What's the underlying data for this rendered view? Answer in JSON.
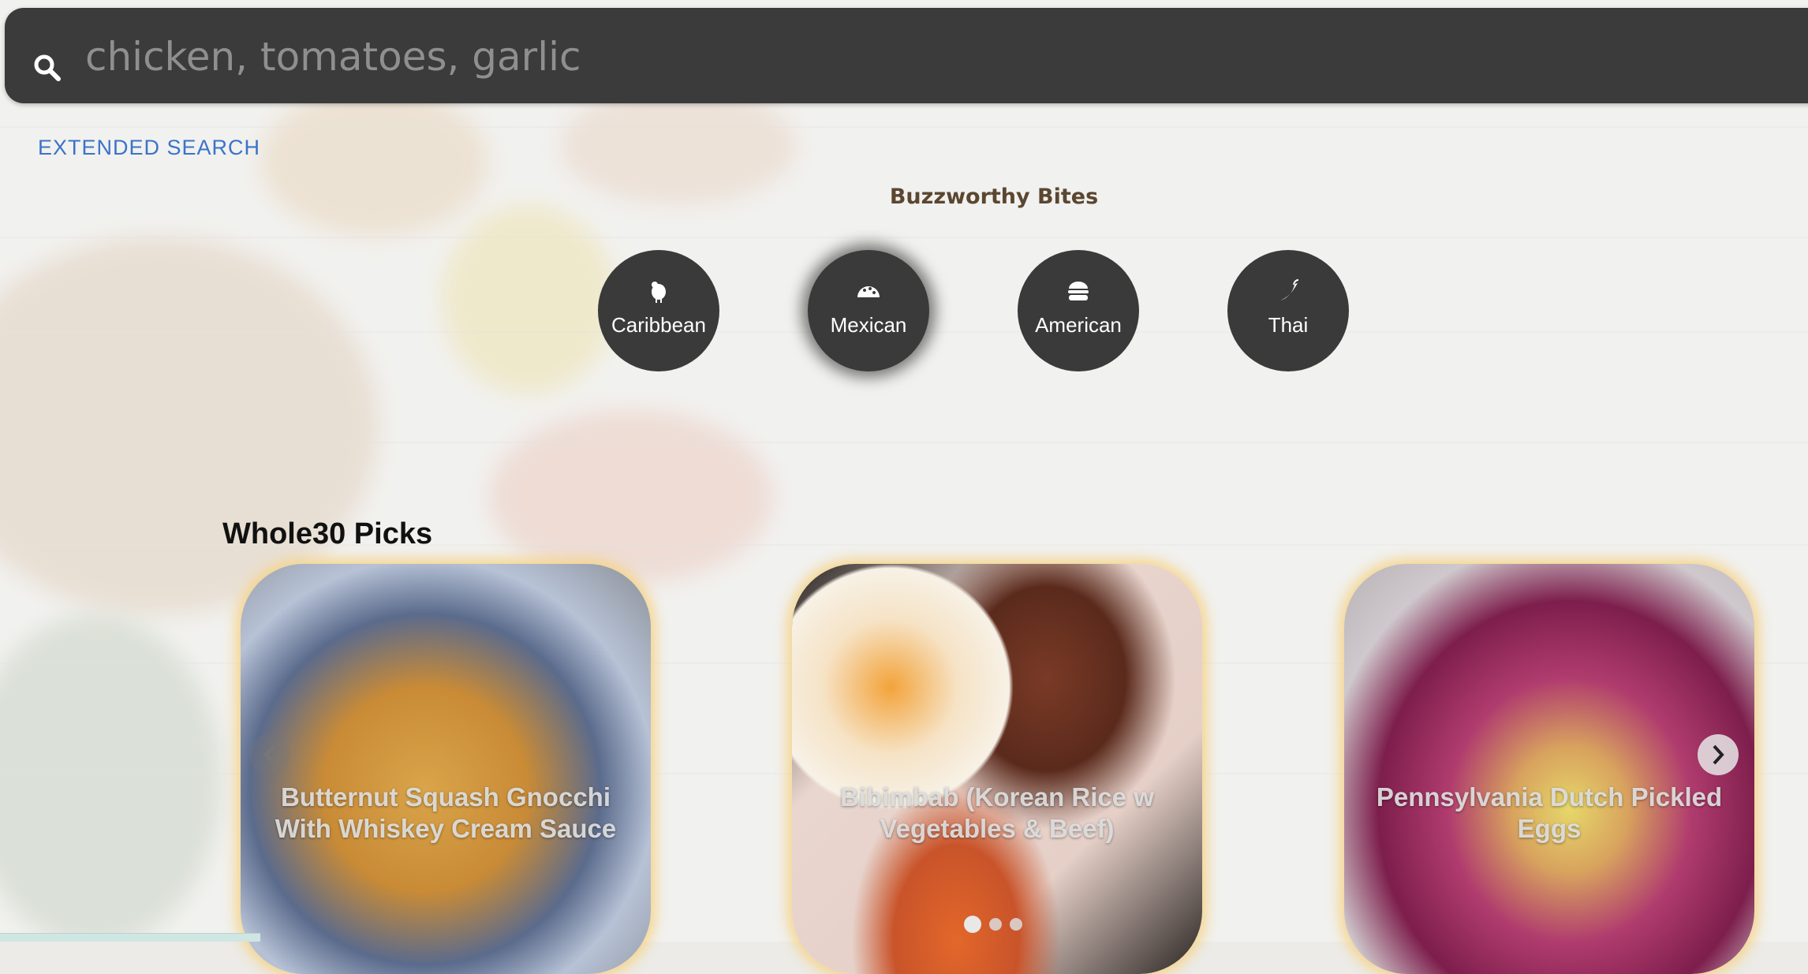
{
  "search": {
    "placeholder": "chicken, tomatoes, garlic",
    "icon": "search-icon"
  },
  "extended_search": {
    "label": "EXTENDED SEARCH"
  },
  "buzzworthy": {
    "title": "Buzzworthy Bites",
    "items": [
      {
        "label": "Caribbean",
        "icon": "chicken-icon",
        "active": false
      },
      {
        "label": "Mexican",
        "icon": "taco-icon",
        "active": true
      },
      {
        "label": "American",
        "icon": "burger-icon",
        "active": false
      },
      {
        "label": "Thai",
        "icon": "chili-pepper-icon",
        "active": false
      }
    ]
  },
  "picks": {
    "title": "Whole30 Picks",
    "cards": [
      {
        "title": "Butternut Squash Gnocchi With Whiskey Cream Sauce"
      },
      {
        "title": "Bibimbab (Korean Rice w Vegetables & Beef)"
      },
      {
        "title": "Pennsylvania Dutch Pickled Eggs"
      }
    ],
    "pagination": {
      "pages": 3,
      "current": 1
    }
  },
  "colors": {
    "search_bar": "#3b3b3b",
    "link": "#3b73c8",
    "section_title": "#5b4630",
    "cuisine_circle": "#3a3a3a",
    "card_glow": "#f6d282"
  }
}
